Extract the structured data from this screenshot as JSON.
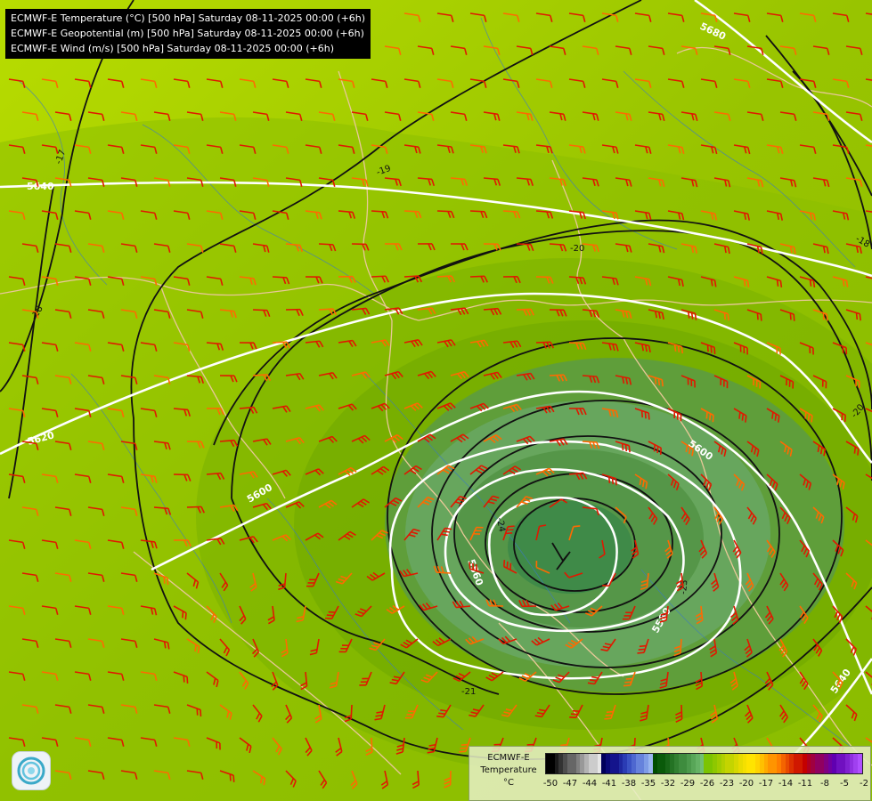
{
  "header": {
    "lines": [
      "ECMWF-E Temperature (°C) [500 hPa] Saturday 08-11-2025 00:00 (+6h)",
      "ECMWF-E Geopotential (m) [500 hPa] Saturday 08-11-2025 00:00 (+6h)",
      "ECMWF-E Wind (m/s) [500 hPa] Saturday 08-11-2025 00:00 (+6h)"
    ]
  },
  "map": {
    "geopotential_labels": [
      "5680",
      "5640",
      "5620",
      "5600",
      "5600",
      "5560",
      "5580",
      "5640"
    ],
    "temperature_labels": [
      "-17",
      "-19",
      "-20",
      "-18",
      "-18",
      "-20",
      "-24",
      "-23",
      "-21"
    ]
  },
  "legend": {
    "title_line1": "ECMWF-E",
    "title_line2": "Temperature",
    "title_line3": "°C",
    "ticks": [
      "-50",
      "-47",
      "-44",
      "-41",
      "-38",
      "-35",
      "-32",
      "-29",
      "-26",
      "-23",
      "-20",
      "-17",
      "-14",
      "-11",
      "-8",
      "-5",
      "-2"
    ]
  },
  "colors": {
    "background_warm": "#a6cc00",
    "cold_core": "#3f8a48",
    "contour_white": "#ffffff",
    "contour_black": "#111111",
    "wind_barb_red": "#e01800",
    "wind_barb_orange": "#ff6a00",
    "border_beige": "#e8c898",
    "river_blue": "#3a78c8"
  },
  "icons": {
    "logo": "swirl-logo-icon"
  }
}
